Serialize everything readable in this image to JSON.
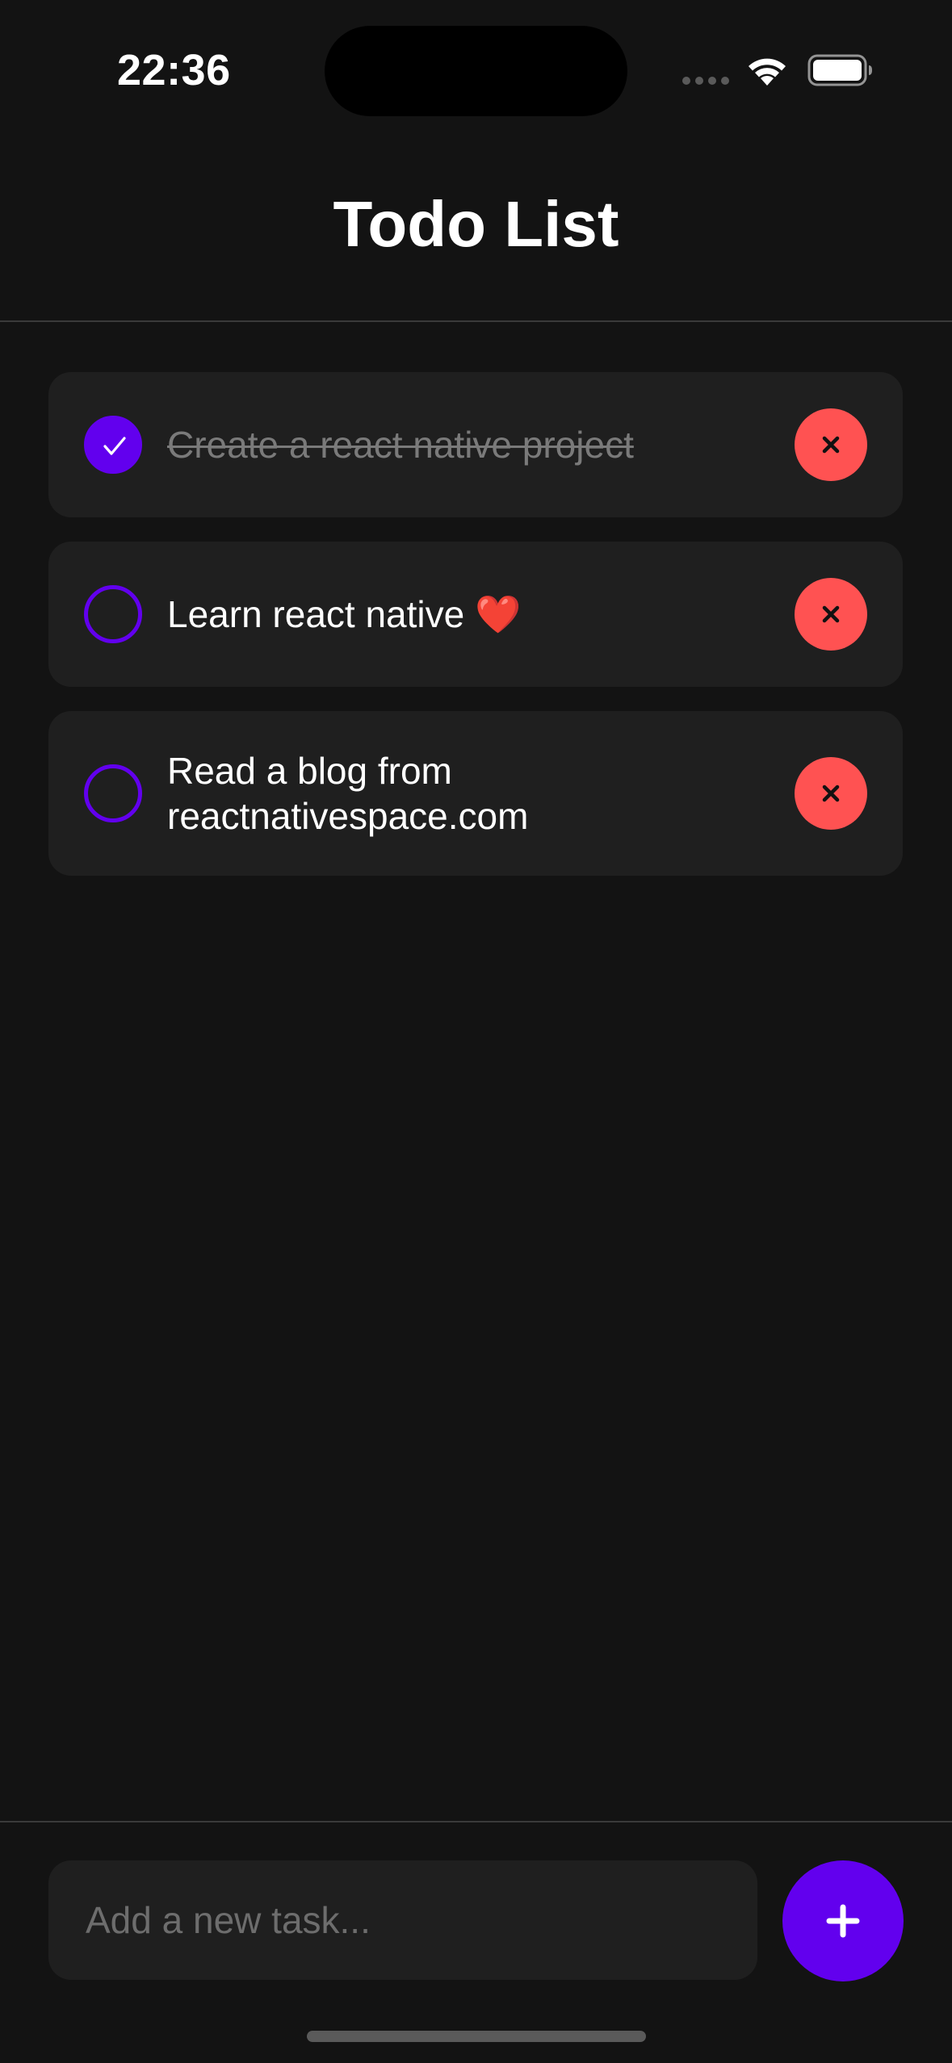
{
  "status_bar": {
    "time": "22:36",
    "icons": [
      "cellular-dots-icon",
      "wifi-icon",
      "battery-icon"
    ]
  },
  "header": {
    "title": "Todo List"
  },
  "tasks": [
    {
      "text": "Create a react native project",
      "completed": true
    },
    {
      "text": "Learn react native",
      "emoji": "❤️",
      "completed": false
    },
    {
      "text_line1": "Read a blog from",
      "text_line2": "reactnativespace.com",
      "completed": false
    }
  ],
  "input": {
    "placeholder": "Add a new task...",
    "value": ""
  },
  "icons": {
    "check": "check-icon",
    "delete": "close-icon",
    "add": "plus-icon"
  },
  "colors": {
    "background": "#131313",
    "card": "#1f1f1f",
    "accent": "#6200ee",
    "delete": "#ff5252",
    "completed_text": "#7a7a7a"
  }
}
